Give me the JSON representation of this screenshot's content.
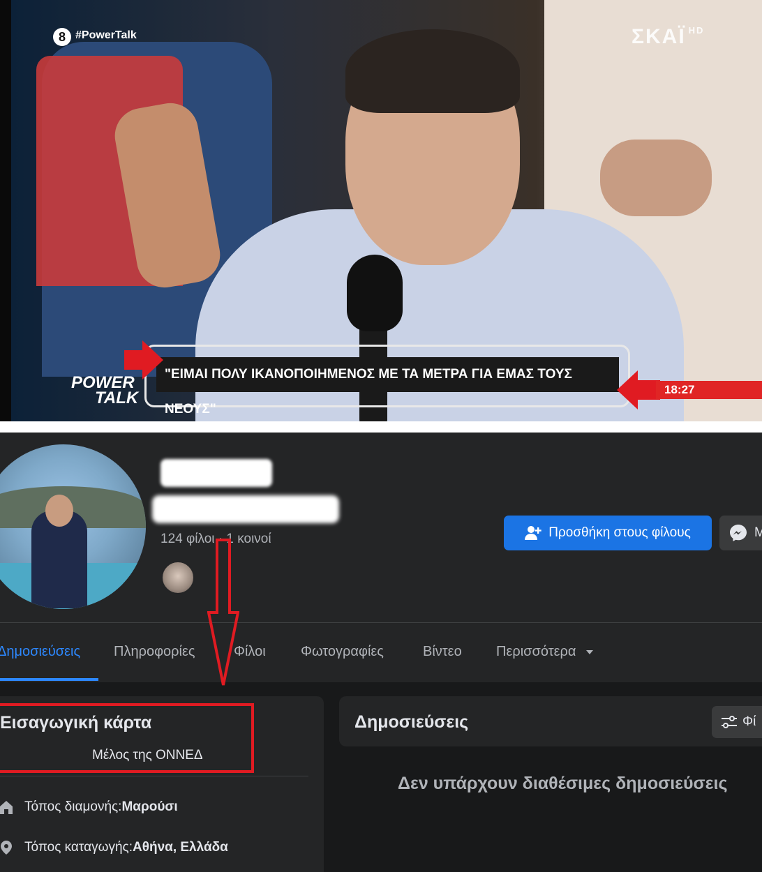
{
  "tv": {
    "channel_number": "8",
    "hashtag": "#PowerTalk",
    "channel_logo": "ΣΚΑΪ",
    "channel_logo_suffix": "HD",
    "show_logo_line1": "POWER",
    "show_logo_line2": "TALK",
    "caption": "\"ΕΙΜΑΙ ΠΟΛΥ ΙΚΑΝΟΠΟΙΗΜΕΝΟΣ ΜΕ ΤΑ ΜΕΤΡΑ ΓΙΑ ΕΜΑΣ ΤΟΥΣ ΝΕΟΥΣ\"",
    "time": "18:27"
  },
  "profile": {
    "friends_text": "124 φίλοι · 1 κοινοί",
    "add_friend_label": "Προσθήκη στους φίλους",
    "message_label": "Μ"
  },
  "tabs": [
    {
      "label": "Δημοσιεύσεις",
      "active": true
    },
    {
      "label": "Πληροφορίες",
      "active": false
    },
    {
      "label": "Φίλοι",
      "active": false
    },
    {
      "label": "Φωτογραφίες",
      "active": false
    },
    {
      "label": "Βίντεο",
      "active": false
    },
    {
      "label": "Περισσότερα",
      "active": false
    }
  ],
  "intro": {
    "title": "Εισαγωγική κάρτα",
    "bio": "Μέλος της ΟΝΝΕΔ",
    "residence_label": "Τόπος διαμονής: ",
    "residence_value": "Μαρούσι",
    "origin_label": "Τόπος καταγωγής: ",
    "origin_value": "Αθήνα, Ελλάδα"
  },
  "posts": {
    "title": "Δημοσιεύσεις",
    "filter_label": "Φί",
    "empty_text": "Δεν υπάρχουν διαθέσιμες δημοσιεύσεις"
  },
  "colors": {
    "accent": "#2d88ff",
    "button_blue": "#1b74e4",
    "annotation_red": "#e01b22",
    "fb_card": "#242526",
    "fb_bg": "#18191a"
  }
}
